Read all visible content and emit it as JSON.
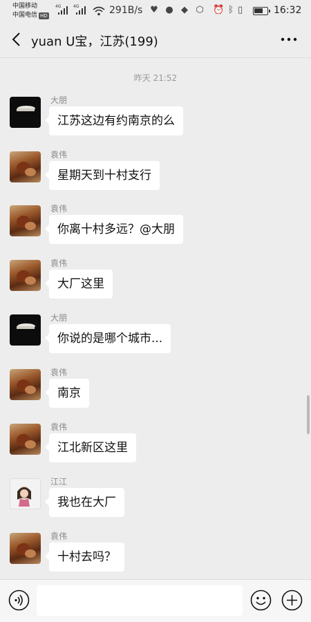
{
  "status_bar": {
    "carrier1": "中国移动",
    "carrier2": "中国电信",
    "hd": "HD",
    "network": "4G",
    "speed": "291B/s",
    "time": "16:32",
    "icons": [
      "heart-rate-icon",
      "wechat-icon",
      "app-icon",
      "shield-icon",
      "alarm-icon",
      "bluetooth-icon",
      "vibrate-icon",
      "battery-icon"
    ]
  },
  "header": {
    "title": "yuan U宝，江苏(199)",
    "back_icon": "back-chevron-icon",
    "more_icon": "more-dots-icon"
  },
  "chat": {
    "timestamp": "昨天 21:52",
    "messages": [
      {
        "sender": "大朋",
        "text": "江苏这边有约南京的么",
        "avatar": "dapeng"
      },
      {
        "sender": "袁伟",
        "text": "星期天到十村支行",
        "avatar": "yuanwei"
      },
      {
        "sender": "袁伟",
        "text": "你离十村多远？@大朋",
        "avatar": "yuanwei"
      },
      {
        "sender": "袁伟",
        "text": "大厂这里",
        "avatar": "yuanwei"
      },
      {
        "sender": "大朋",
        "text": "你说的是哪个城市...",
        "avatar": "dapeng"
      },
      {
        "sender": "袁伟",
        "text": "南京",
        "avatar": "yuanwei"
      },
      {
        "sender": "袁伟",
        "text": "江北新区这里",
        "avatar": "yuanwei"
      },
      {
        "sender": "江江",
        "text": "我也在大厂",
        "avatar": "jiangjiang"
      },
      {
        "sender": "袁伟",
        "text": "十村去吗？",
        "avatar": "yuanwei"
      }
    ]
  },
  "input_bar": {
    "value": "",
    "icons": [
      "voice-icon",
      "emoji-icon",
      "plus-icon"
    ]
  }
}
